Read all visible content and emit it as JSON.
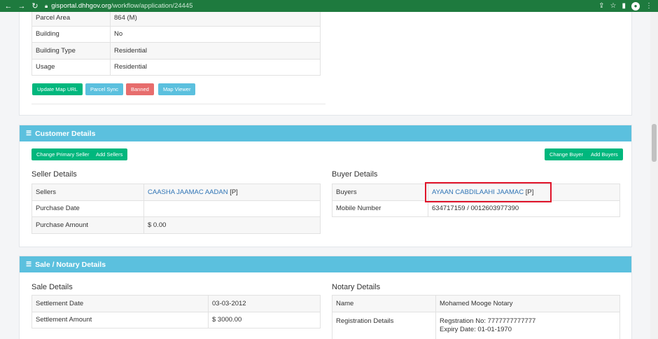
{
  "browser": {
    "url_host": "gisportal.dhhgov.org",
    "url_path": "/workflow/application/24445"
  },
  "parcel": {
    "rows": [
      {
        "label": "Parcel Area",
        "value": "864 (M)"
      },
      {
        "label": "Building",
        "value": "No"
      },
      {
        "label": "Building Type",
        "value": "Residential"
      },
      {
        "label": "Usage",
        "value": "Residential"
      }
    ],
    "buttons": {
      "update_map_url": "Update Map URL",
      "parcel_sync": "Parcel Sync",
      "banned": "Banned",
      "map_viewer": "Map Viewer"
    }
  },
  "customer": {
    "header": "Customer Details",
    "buttons": {
      "change_primary_seller": "Change Primary Seller",
      "add_sellers": "Add Sellers",
      "change_buyer": "Change Buyer",
      "add_buyers": "Add Buyers"
    },
    "seller": {
      "title": "Seller Details",
      "sellers_label": "Sellers",
      "sellers_name": "CAASHA JAAMAC AADAN",
      "sellers_tag": "[P]",
      "purchase_date_label": "Purchase Date",
      "purchase_date_value": "",
      "purchase_amount_label": "Purchase Amount",
      "purchase_amount_value": "$ 0.00"
    },
    "buyer": {
      "title": "Buyer Details",
      "buyers_label": "Buyers",
      "buyers_name": "AYAAN CABDILAAHI JAAMAC",
      "buyers_tag": "[P]",
      "mobile_label": "Mobile Number",
      "mobile_value": "634717159 / 0012603977390"
    }
  },
  "sale": {
    "header": "Sale / Notary Details",
    "sale_details": {
      "title": "Sale Details",
      "settlement_date_label": "Settlement Date",
      "settlement_date_value": "03-03-2012",
      "settlement_amount_label": "Settlement Amount",
      "settlement_amount_value": "$ 3000.00"
    },
    "notary_details": {
      "title": "Notary Details",
      "name_label": "Name",
      "name_value": "Mohamed Mooge Notary",
      "registration_label": "Registration Details",
      "registration_no": "Regstration No: 7777777777777",
      "expiry_date": "Expiry Date: 01-01-1970"
    }
  },
  "colors": {
    "header_bg": "#5bc0de",
    "success": "#00b77d",
    "danger": "#e76d6d",
    "link": "#2f74b5",
    "highlight": "#e0142a"
  }
}
